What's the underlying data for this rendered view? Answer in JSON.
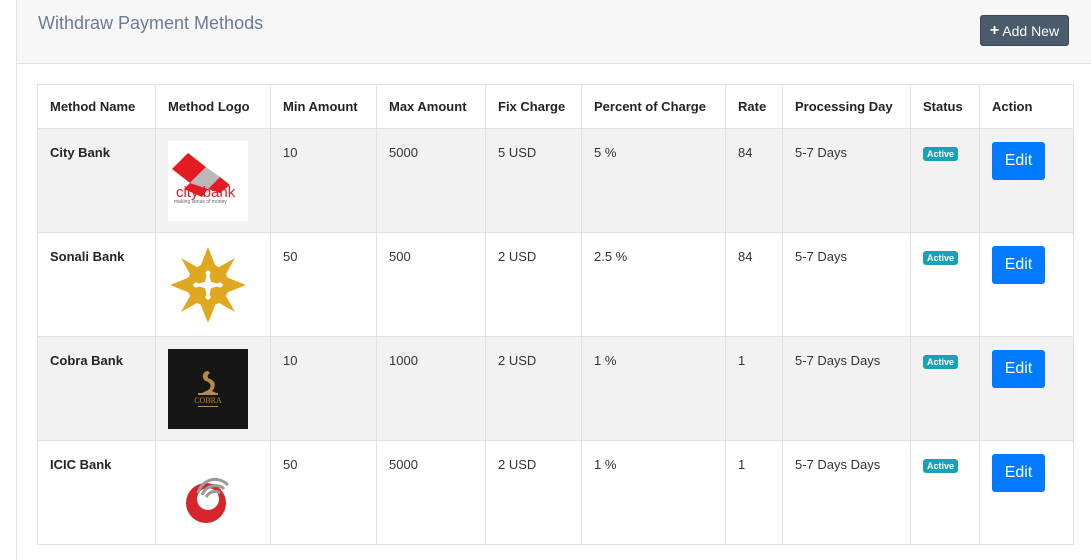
{
  "header": {
    "title": "Withdraw Payment Methods",
    "add_label": "Add New"
  },
  "table": {
    "columns": [
      "Method Name",
      "Method Logo",
      "Min Amount",
      "Max Amount",
      "Fix Charge",
      "Percent of Charge",
      "Rate",
      "Processing Day",
      "Status",
      "Action"
    ],
    "rows": [
      {
        "name": "City Bank",
        "logo": "city-bank-logo",
        "min": "10",
        "max": "5000",
        "fix": "5 USD",
        "percent": "5 %",
        "rate": "84",
        "days": "5-7 Days",
        "status": "Active",
        "action": "Edit"
      },
      {
        "name": "Sonali Bank",
        "logo": "sonali-bank-logo",
        "min": "50",
        "max": "500",
        "fix": "2 USD",
        "percent": "2.5 %",
        "rate": "84",
        "days": "5-7 Days",
        "status": "Active",
        "action": "Edit"
      },
      {
        "name": "Cobra Bank",
        "logo": "cobra-bank-logo",
        "min": "10",
        "max": "1000",
        "fix": "2 USD",
        "percent": "1 %",
        "rate": "1",
        "days": "5-7 Days Days",
        "status": "Active",
        "action": "Edit"
      },
      {
        "name": "ICIC Bank",
        "logo": "icic-bank-logo",
        "min": "50",
        "max": "5000",
        "fix": "2 USD",
        "percent": "1 %",
        "rate": "1",
        "days": "5-7 Days Days",
        "status": "Active",
        "action": "Edit"
      }
    ]
  },
  "logos": {
    "city": {
      "word": "city bank",
      "tagline": "making sense of money"
    },
    "cobra": {
      "word": "COBRA"
    }
  },
  "colors": {
    "status_badge": "#17a2b8",
    "edit_button": "#007bff",
    "add_button": "#4a5b6b"
  }
}
